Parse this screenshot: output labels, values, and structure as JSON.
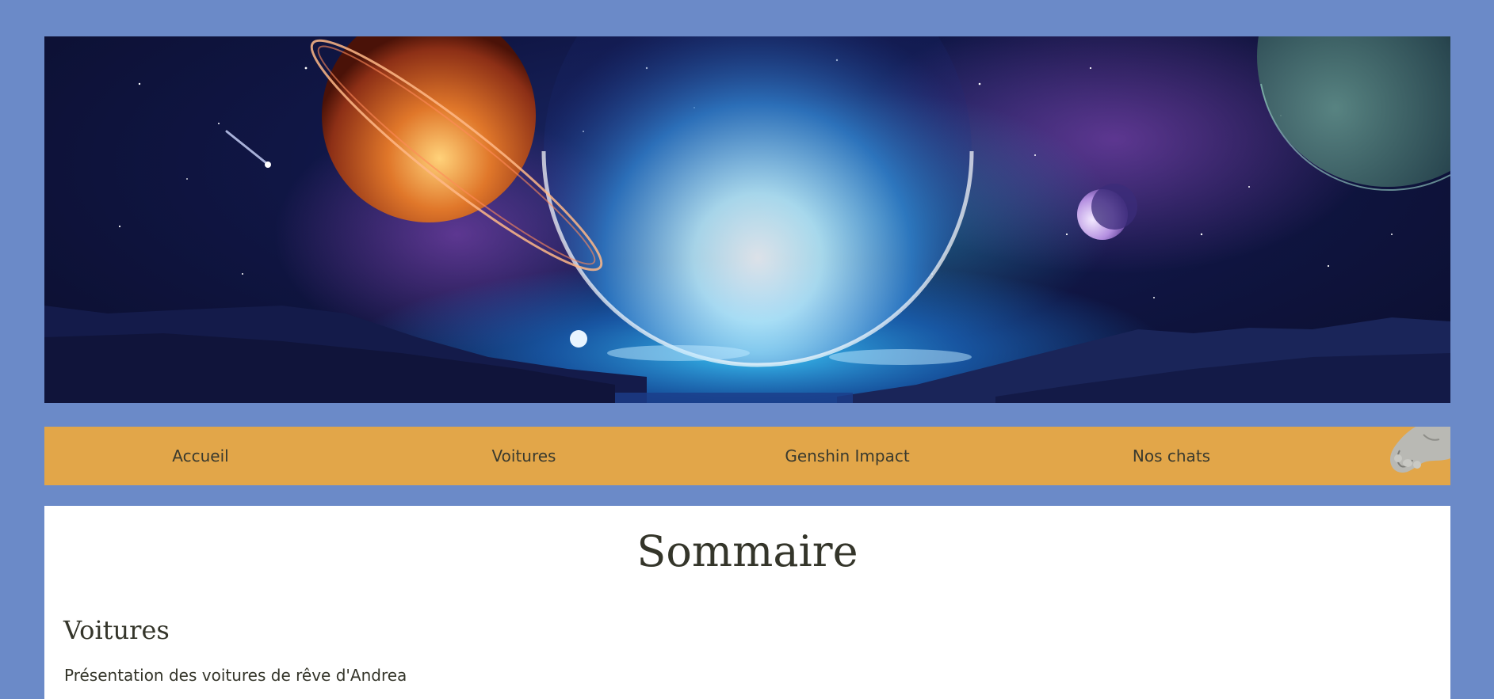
{
  "nav": {
    "items": [
      {
        "label": "Accueil"
      },
      {
        "label": "Voitures"
      },
      {
        "label": "Genshin Impact"
      },
      {
        "label": "Nos chats"
      }
    ],
    "background_color": "#e2a649"
  },
  "main": {
    "title": "Sommaire",
    "sections": [
      {
        "title": "Voitures",
        "description": "Présentation des voitures de rêve d'Andrea"
      }
    ]
  },
  "colors": {
    "page_background": "#6b8ac8",
    "text": "#34352a",
    "content_background": "#ffffff"
  },
  "icons": {
    "banner": "space-landscape-banner-image",
    "nav_corner": "cat-paw-image"
  }
}
